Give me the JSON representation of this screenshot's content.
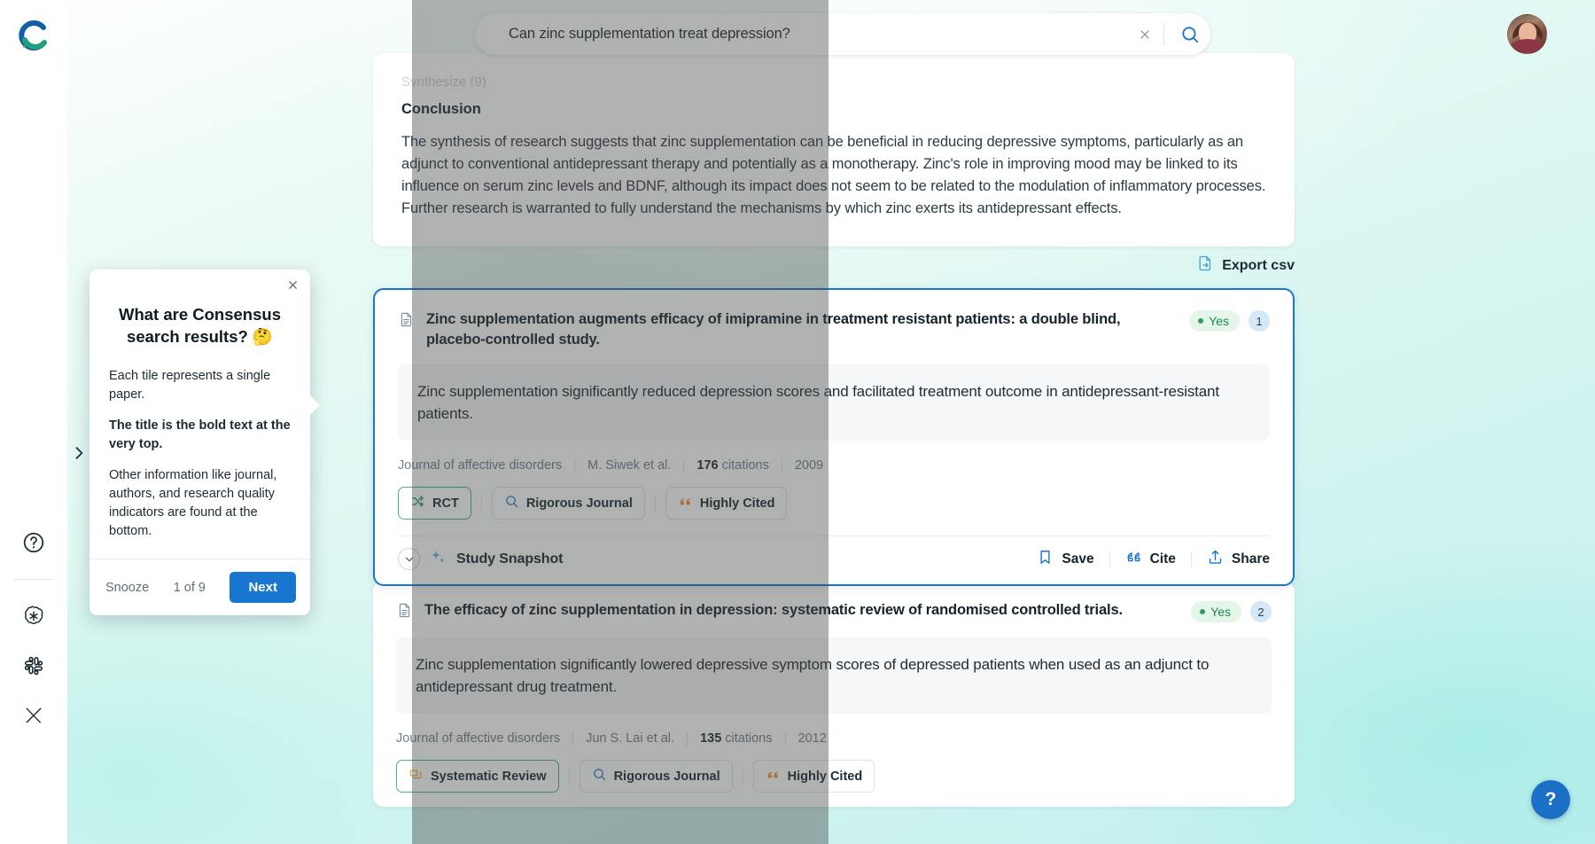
{
  "brand": {
    "logo_alt": "Consensus logo"
  },
  "search": {
    "query": "Can zinc supplementation treat depression?",
    "clear_icon": "close-icon",
    "submit_icon": "search-icon"
  },
  "sidebar": {
    "expand_icon": "chevron-right-icon",
    "items": [
      {
        "icon": "help-circle-icon",
        "name": "help"
      },
      {
        "icon": "openai-icon",
        "name": "openai"
      },
      {
        "icon": "slack-icon",
        "name": "slack"
      },
      {
        "icon": "x-twitter-icon",
        "name": "x-twitter"
      }
    ]
  },
  "summary": {
    "fade_text": "Synthesize (9)",
    "heading": "Conclusion",
    "body": "The synthesis of research suggests that zinc supplementation can be beneficial in reducing depressive symptoms, particularly as an adjunct to conventional antidepressant therapy and potentially as a monotherapy. Zinc's role in improving mood may be linked to its influence on serum zinc levels and BDNF, although its impact does not seem to be related to the modulation of inflammatory processes. Further research is warranted to fully understand the mechanisms by which zinc exerts its antidepressant effects."
  },
  "export": {
    "label": "Export csv",
    "icon": "export-file-icon"
  },
  "papers": [
    {
      "title": "Zinc supplementation augments efficacy of imipramine in treatment resistant patients: a double blind, placebo-controlled study.",
      "verdict": "Yes",
      "index": "1",
      "claim": "Zinc supplementation significantly reduced depression scores and facilitated treatment outcome in antidepressant-resistant patients.",
      "journal": "Journal of affective disorders",
      "authors": "M. Siwek et al.",
      "citations_count": "176",
      "citations_label": "citations",
      "year": "2009",
      "chips": [
        {
          "label": "RCT",
          "icon": "shuffle-icon",
          "style": "green"
        },
        {
          "label": "Rigorous Journal",
          "icon": "magnifier-icon",
          "style": "plain"
        },
        {
          "label": "Highly Cited",
          "icon": "quote-icon",
          "style": "plain"
        }
      ],
      "snapshot_label": "Study Snapshot",
      "actions": [
        {
          "label": "Save",
          "icon": "bookmark-icon"
        },
        {
          "label": "Cite",
          "icon": "quote-icon"
        },
        {
          "label": "Share",
          "icon": "share-icon"
        }
      ]
    },
    {
      "title": "The efficacy of zinc supplementation in depression: systematic review of randomised controlled trials.",
      "verdict": "Yes",
      "index": "2",
      "claim": "Zinc supplementation significantly lowered depressive symptom scores of depressed patients when used as an adjunct to antidepressant drug treatment.",
      "journal": "Journal of affective disorders",
      "authors": "Jun S. Lai et al.",
      "citations_count": "135",
      "citations_label": "citations",
      "year": "2012",
      "chips": [
        {
          "label": "Systematic Review",
          "icon": "layers-icon",
          "style": "green"
        },
        {
          "label": "Rigorous Journal",
          "icon": "magnifier-icon",
          "style": "plain"
        },
        {
          "label": "Highly Cited",
          "icon": "quote-icon",
          "style": "plain"
        }
      ]
    }
  ],
  "tooltip": {
    "title": "What are Consensus search results? 🤔",
    "paragraphs": [
      "Each tile represents a single paper.",
      "The title is the bold text at the very top.",
      "Other information like journal, authors, and research quality indicators are found at the bottom."
    ],
    "snooze_label": "Snooze",
    "progress": "1 of 9",
    "next_label": "Next",
    "close_icon": "close-icon"
  },
  "help_fab": {
    "label": "?",
    "icon": "help-circle-icon"
  },
  "colors": {
    "accent_blue": "#1876d1",
    "verdict_green": "#2ca35c",
    "chip_green": "#49b87e",
    "highly_cited_orange": "#f08a24"
  }
}
